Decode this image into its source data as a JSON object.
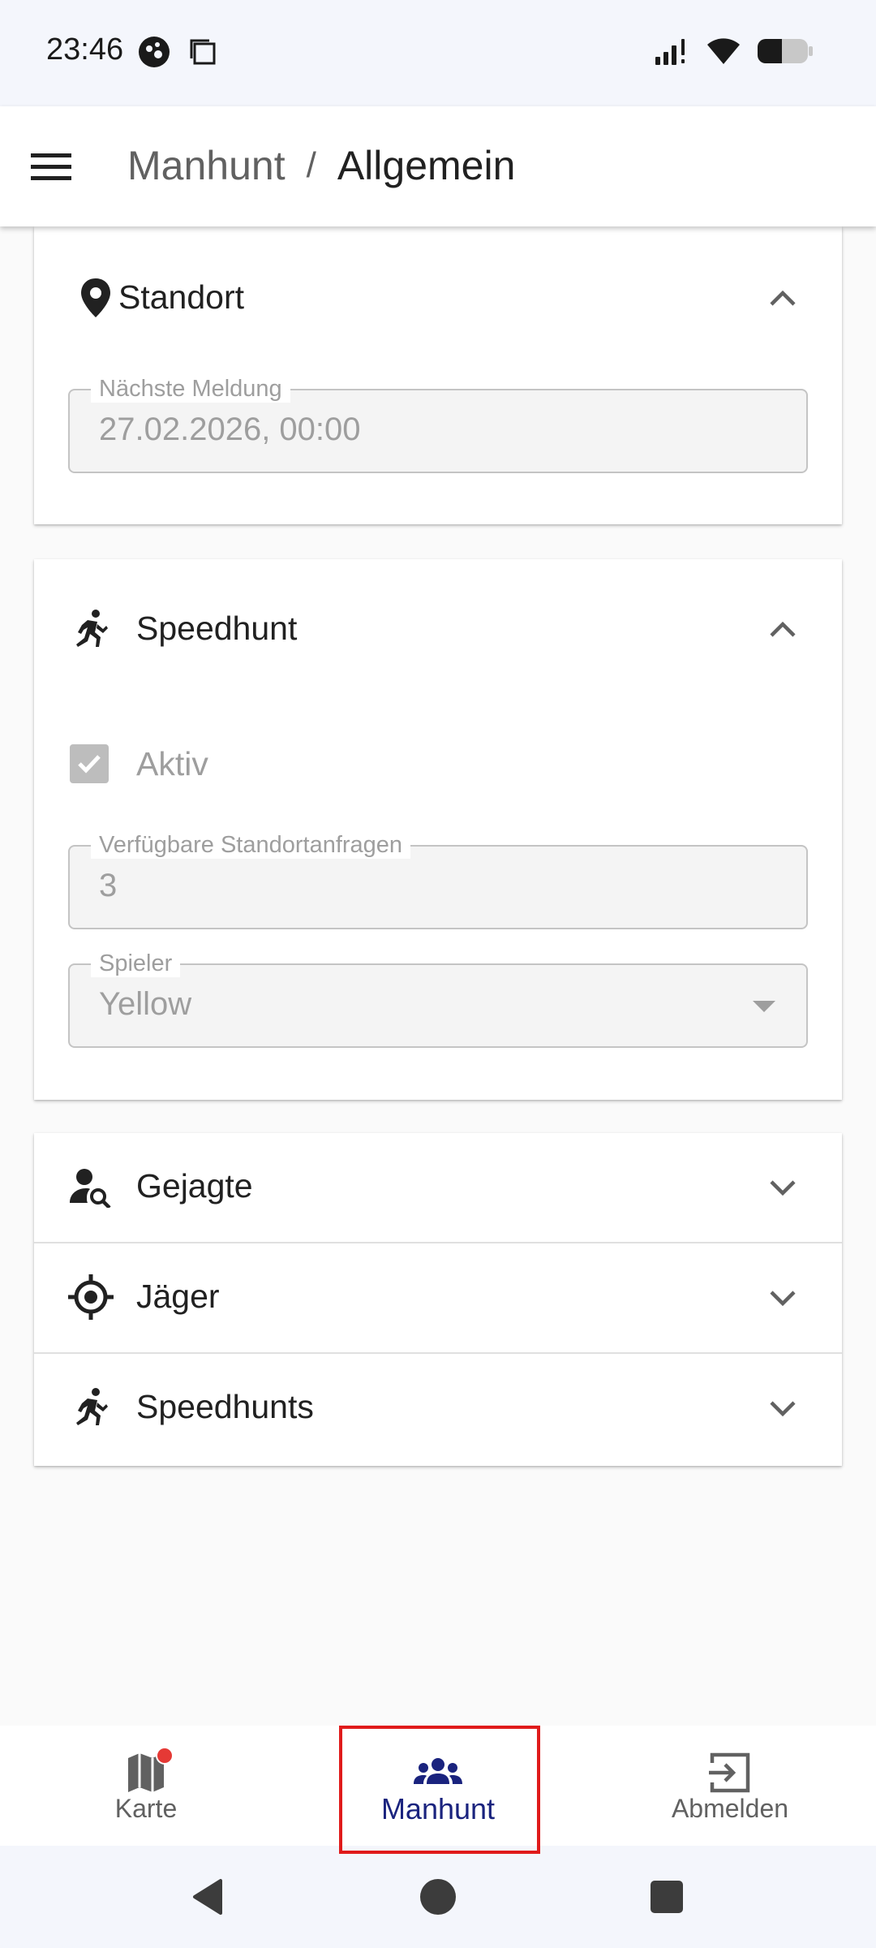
{
  "status_bar": {
    "time": "23:46"
  },
  "app_bar": {
    "parent": "Manhunt",
    "separator": "/",
    "current": "Allgemein"
  },
  "standort": {
    "title": "Standort",
    "icon": "location-pin-icon",
    "next_report_label": "Nächste Meldung",
    "next_report_value": "27.02.2026, 00:00"
  },
  "speedhunt": {
    "title": "Speedhunt",
    "icon": "running-person-icon",
    "active_label": "Aktiv",
    "active_checked": true,
    "requests_label": "Verfügbare Standortanfragen",
    "requests_value": "3",
    "player_label": "Spieler",
    "player_value": "Yellow"
  },
  "sections": [
    {
      "title": "Gejagte",
      "icon": "person-search-icon"
    },
    {
      "title": "Jäger",
      "icon": "crosshair-icon"
    },
    {
      "title": "Speedhunts",
      "icon": "running-person-icon"
    }
  ],
  "bottom_nav": {
    "items": [
      {
        "label": "Karte",
        "icon": "map-icon",
        "badge": true
      },
      {
        "label": "Manhunt",
        "icon": "group-icon",
        "active": true
      },
      {
        "label": "Abmelden",
        "icon": "logout-icon"
      }
    ]
  },
  "colors": {
    "accent": "#1a237e",
    "badge": "#e53935",
    "highlight": "#e01b1b"
  }
}
